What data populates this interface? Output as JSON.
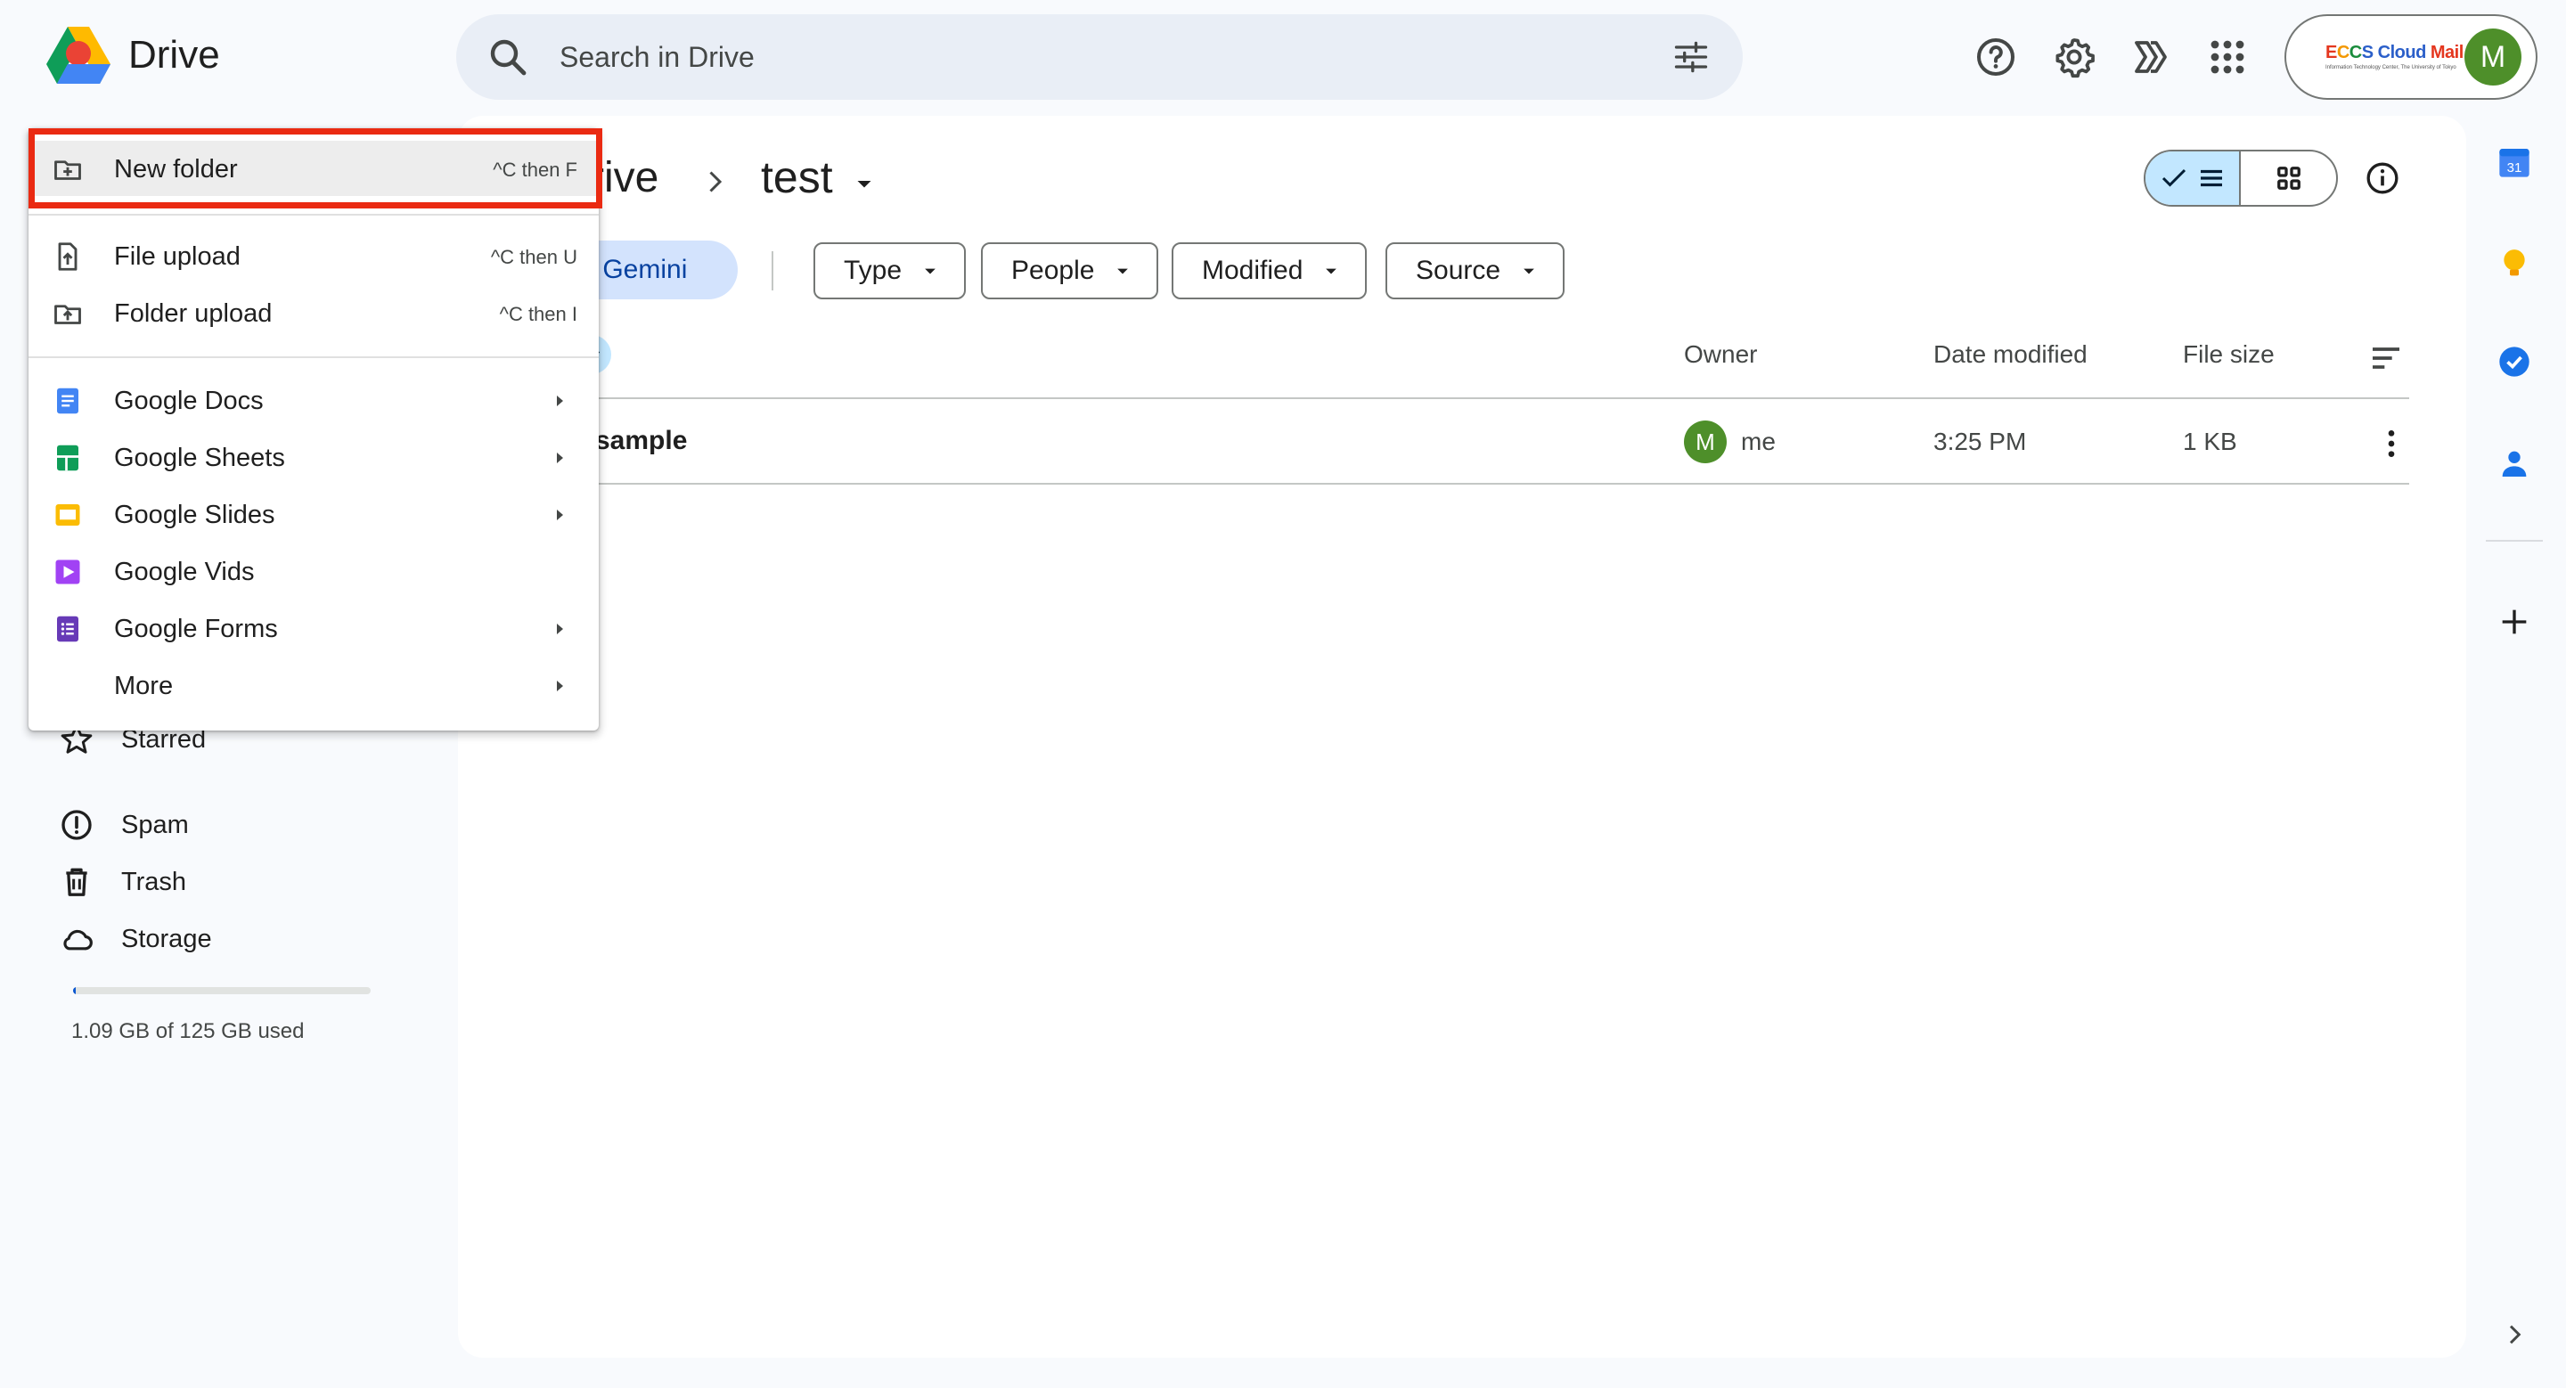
{
  "app": {
    "name": "Drive"
  },
  "search": {
    "placeholder": "Search in Drive"
  },
  "account": {
    "brand": "ECCS Cloud Mail",
    "brand_sub": "Information Technology Center, The University of Tokyo",
    "avatar_initial": "M"
  },
  "breadcrumb": {
    "parent_partial": "rive",
    "current": "test"
  },
  "filters": {
    "gemini_partial": "sk Gemini",
    "chips": [
      "Type",
      "People",
      "Modified",
      "Source"
    ]
  },
  "table": {
    "columns": {
      "owner": "Owner",
      "date_modified": "Date modified",
      "file_size": "File size"
    },
    "rows": [
      {
        "name": "sample",
        "owner_initial": "M",
        "owner": "me",
        "date_modified": "3:25 PM",
        "file_size": "1 KB"
      }
    ]
  },
  "sidebar": {
    "items": [
      {
        "label": "Starred",
        "icon": "star-icon"
      },
      {
        "label": "Spam",
        "icon": "spam-icon"
      },
      {
        "label": "Trash",
        "icon": "trash-icon"
      },
      {
        "label": "Storage",
        "icon": "cloud-icon"
      }
    ],
    "storage_text": "1.09 GB of 125 GB used",
    "storage_fraction": 0.0087
  },
  "new_menu": {
    "new_folder": {
      "label": "New folder",
      "shortcut": "^C then F"
    },
    "file_upload": {
      "label": "File upload",
      "shortcut": "^C then U"
    },
    "folder_upload": {
      "label": "Folder upload",
      "shortcut": "^C then I"
    },
    "google_docs": {
      "label": "Google Docs"
    },
    "google_sheets": {
      "label": "Google Sheets"
    },
    "google_slides": {
      "label": "Google Slides"
    },
    "google_vids": {
      "label": "Google Vids"
    },
    "google_forms": {
      "label": "Google Forms"
    },
    "more": {
      "label": "More"
    }
  },
  "right_rail": {
    "calendar_day": "31"
  },
  "colors": {
    "highlight_box": "#ea2a12",
    "accent_blue": "#0b57d0",
    "selected_chip": "#c2e7ff",
    "avatar_green": "#4e8f2a"
  }
}
